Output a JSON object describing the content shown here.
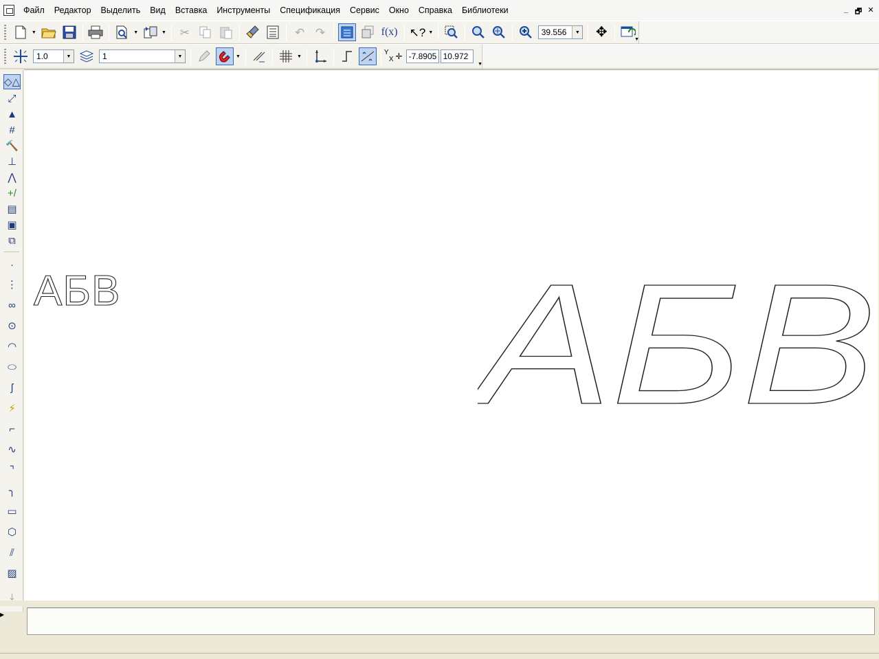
{
  "menu": {
    "items": [
      {
        "id": "file",
        "label": "Файл"
      },
      {
        "id": "edit",
        "label": "Редактор"
      },
      {
        "id": "select",
        "label": "Выделить"
      },
      {
        "id": "view",
        "label": "Вид"
      },
      {
        "id": "insert",
        "label": "Вставка"
      },
      {
        "id": "tools",
        "label": "Инструменты"
      },
      {
        "id": "spec",
        "label": "Спецификация"
      },
      {
        "id": "service",
        "label": "Сервис"
      },
      {
        "id": "window",
        "label": "Окно"
      },
      {
        "id": "help",
        "label": "Справка"
      },
      {
        "id": "libraries",
        "label": "Библиотеки"
      }
    ],
    "window_controls": {
      "minimize": "_",
      "restore": "🗗",
      "close": "✕"
    }
  },
  "toolbar_standard": {
    "zoom_value": "39.556",
    "formula_label": "f(x)"
  },
  "toolbar_current_state": {
    "step_value": "1.0",
    "layer_value": "1",
    "coord_x_label": "Y",
    "coord_y_label": "X",
    "coord_x": "-7.8905",
    "coord_y": "10.972"
  },
  "canvas": {
    "small_text": "АБВ",
    "large_text": "АБВ",
    "background": "#ffffff",
    "outline_color": "#222222"
  },
  "statusbar": {
    "text": ""
  }
}
